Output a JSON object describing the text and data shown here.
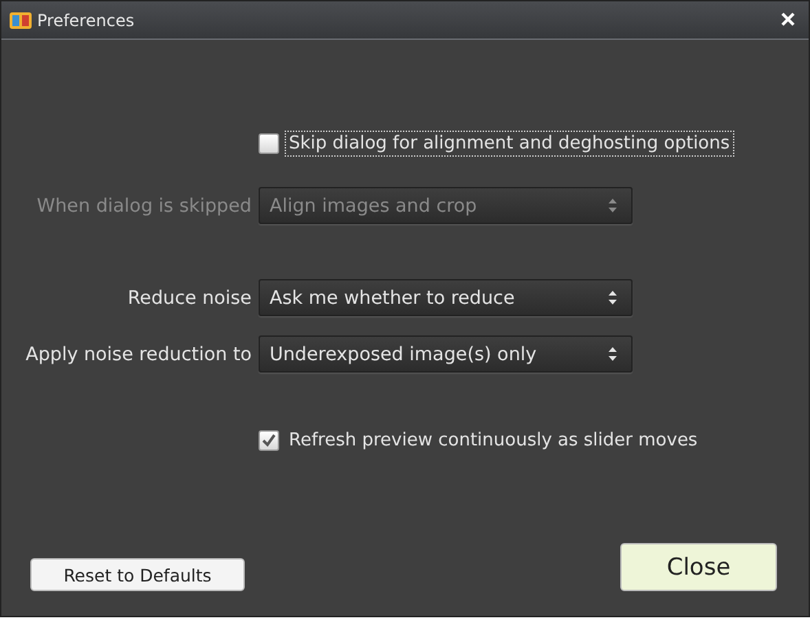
{
  "window": {
    "title": "Preferences"
  },
  "options": [
    {
      "kind": "checkbox",
      "label": "Skip dialog for alignment and deghosting options",
      "checked": false,
      "focused": true
    },
    {
      "kind": "select",
      "label": "When dialog is skipped",
      "value": "Align images and crop",
      "disabled": true
    },
    {
      "kind": "select",
      "label": "Reduce noise",
      "value": "Ask me whether to reduce",
      "disabled": false
    },
    {
      "kind": "select",
      "label": "Apply noise reduction to",
      "value": "Underexposed image(s) only",
      "disabled": false
    },
    {
      "kind": "checkbox",
      "label": "Refresh preview continuously as slider moves",
      "checked": true,
      "focused": false
    }
  ],
  "buttons": [
    {
      "label": "Reset to Defaults",
      "kind": "secondary"
    },
    {
      "label": "Close",
      "kind": "primary"
    }
  ]
}
